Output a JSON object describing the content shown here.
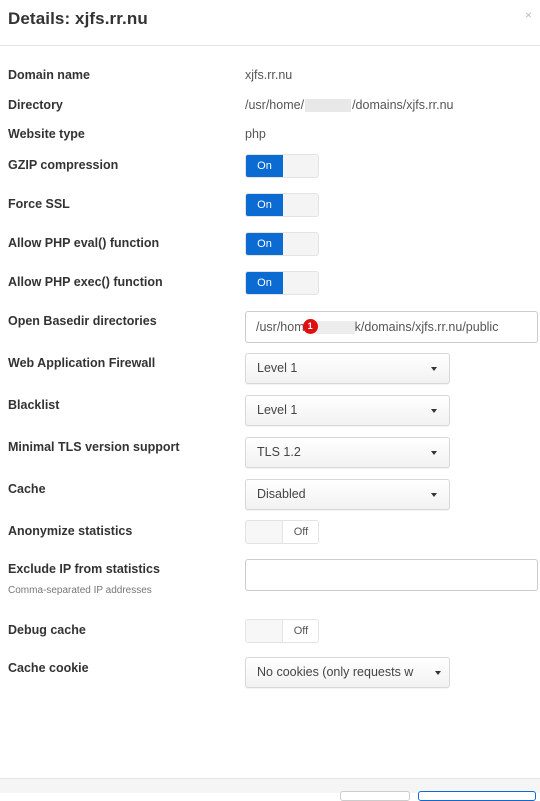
{
  "modal": {
    "title": "Details: xjfs.rr.nu",
    "close_symbol": "×"
  },
  "fields": {
    "domain_name": {
      "label": "Domain name",
      "value": "xjfs.rr.nu"
    },
    "directory": {
      "label": "Directory",
      "value_prefix": "/usr/home/",
      "value_suffix": "/domains/xjfs.rr.nu"
    },
    "website_type": {
      "label": "Website type",
      "value": "php"
    },
    "gzip": {
      "label": "GZIP compression",
      "state": "On"
    },
    "force_ssl": {
      "label": "Force SSL",
      "state": "On"
    },
    "php_eval": {
      "label": "Allow PHP eval() function",
      "state": "On"
    },
    "php_exec": {
      "label": "Allow PHP exec() function",
      "state": "On"
    },
    "open_basedir": {
      "label": "Open Basedir directories",
      "value_prefix": "/usr/hom",
      "badge": "1",
      "value_suffix": "k/domains/xjfs.rr.nu/public"
    },
    "waf": {
      "label": "Web Application Firewall",
      "selected": "Level 1"
    },
    "blacklist": {
      "label": "Blacklist",
      "selected": "Level 1"
    },
    "tls": {
      "label": "Minimal TLS version support",
      "selected": "TLS 1.2"
    },
    "cache": {
      "label": "Cache",
      "selected": "Disabled"
    },
    "anonymize": {
      "label": "Anonymize statistics",
      "state": "Off"
    },
    "exclude_ip": {
      "label": "Exclude IP from statistics",
      "help": "Comma-separated IP addresses",
      "value": ""
    },
    "debug_cache": {
      "label": "Debug cache",
      "state": "Off"
    },
    "cache_cookie": {
      "label": "Cache cookie",
      "selected": "No cookies (only requests w"
    }
  },
  "colors": {
    "toggle_on": "#0b6bd3",
    "badge": "#e01010"
  }
}
